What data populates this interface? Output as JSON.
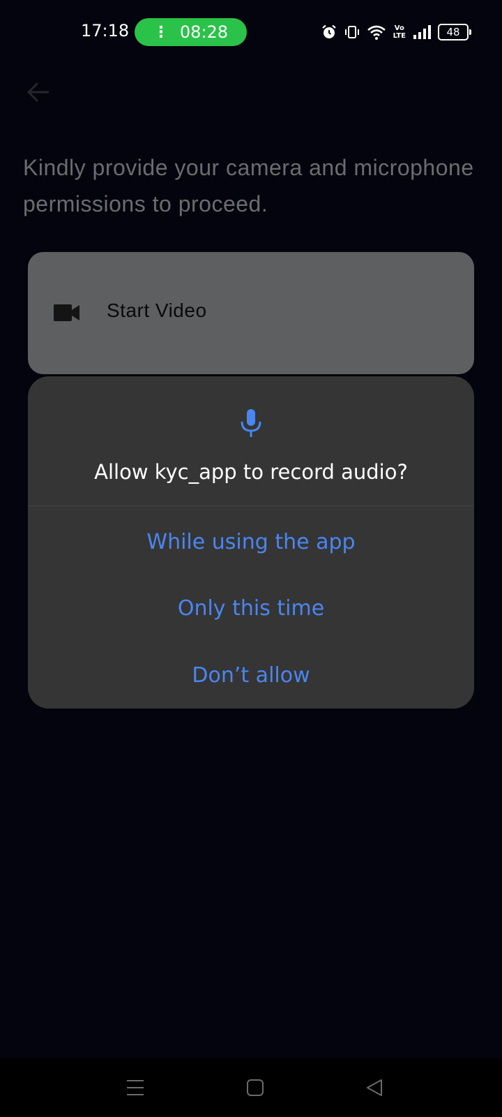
{
  "status_bar": {
    "time": "17:18",
    "call_timer": "08:28",
    "call_icon": "call-in-progress-icon",
    "volte_top": "Vo",
    "volte_bottom": "LTE",
    "battery": "48",
    "icons": [
      "alarm-icon",
      "vibrate-icon",
      "wifi-icon",
      "volte-icon",
      "signal-icon",
      "battery-icon"
    ]
  },
  "app": {
    "back_icon": "arrow-back-icon",
    "prompt": "Kindly provide your camera and microphone permissions to proceed.",
    "start_video_label": "Start Video",
    "start_video_icon": "videocam-icon"
  },
  "dialog": {
    "icon": "microphone-icon",
    "title": "Allow kyc_app to record audio?",
    "options": [
      {
        "label": "While using the app"
      },
      {
        "label": "Only this time"
      },
      {
        "label": "Don’t allow"
      }
    ]
  },
  "nav_bar": {
    "icons": [
      "menu-icon",
      "home-icon",
      "back-icon"
    ]
  },
  "colors": {
    "background": "#03040d",
    "dialog": "#353535",
    "accent": "#4a86f0",
    "call_pill": "#2bc24a",
    "button_dimmed": "#5e5f60"
  }
}
